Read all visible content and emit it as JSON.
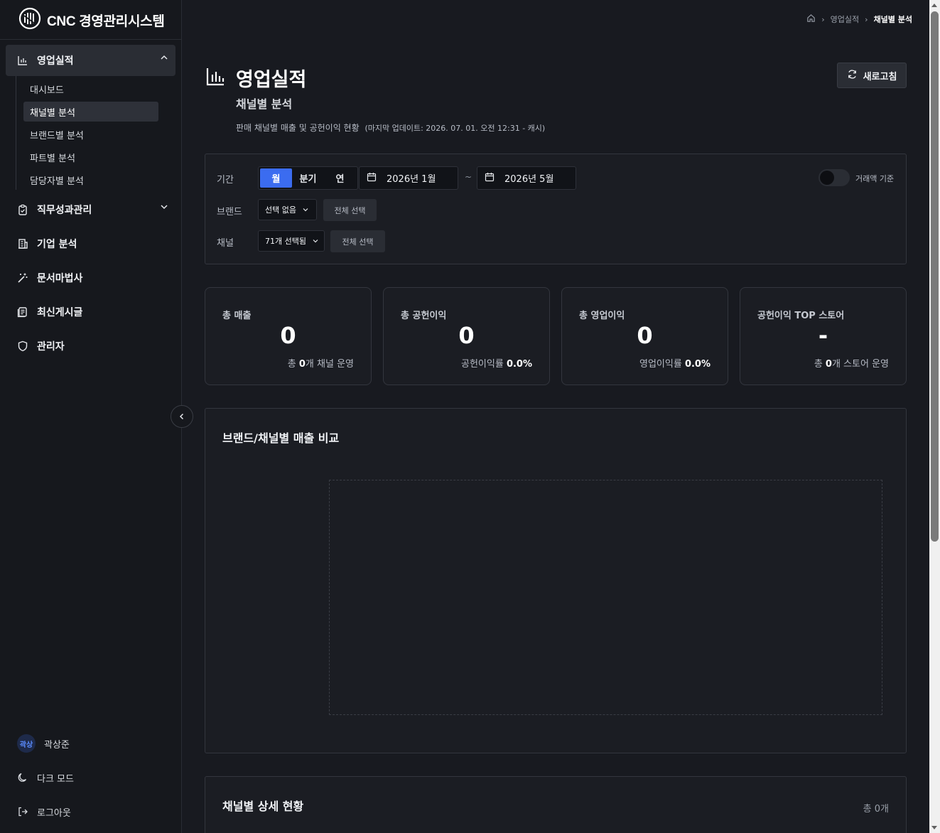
{
  "app": {
    "title": "CNC 경영관리시스템"
  },
  "sidebar": {
    "groups": [
      {
        "label": "영업실적",
        "icon": "bar-chart-icon",
        "expanded": true,
        "items": [
          {
            "label": "대시보드"
          },
          {
            "label": "채널별 분석",
            "active": true
          },
          {
            "label": "브랜드별 분석"
          },
          {
            "label": "파트별 분석"
          },
          {
            "label": "담당자별 분석"
          }
        ]
      },
      {
        "label": "직무성과관리",
        "icon": "clipboard-check-icon",
        "expanded": false
      },
      {
        "label": "기업 분석",
        "icon": "building-icon"
      },
      {
        "label": "문서마법사",
        "icon": "magic-wand-icon"
      },
      {
        "label": "최신게시글",
        "icon": "document-list-icon"
      },
      {
        "label": "관리자",
        "icon": "shield-icon"
      }
    ],
    "user": {
      "avatar_text": "곽상",
      "name": "곽상준"
    },
    "dark_mode_label": "다크 모드",
    "logout_label": "로그아웃"
  },
  "breadcrumb": {
    "items": [
      "영업실적",
      "채널별 분석"
    ]
  },
  "header": {
    "title": "영업실적",
    "subtitle": "채널별 분석",
    "description": "판매 채널별 매출 및 공헌이익 현황",
    "meta": "(마지막 업데이트: 2026. 07. 01. 오전 12:31 - 캐시)",
    "refresh_label": "새로고침"
  },
  "filters": {
    "period_label": "기간",
    "period_options": [
      "월",
      "분기",
      "연"
    ],
    "period_selected": "월",
    "date_from": "2026년 1월",
    "date_separator": "~",
    "date_to": "2026년 5월",
    "toggle_label": "거래액 기준",
    "toggle_on": false,
    "brand_label": "브랜드",
    "brand_value": "선택 없음",
    "brand_select_all": "전체 선택",
    "channel_label": "채널",
    "channel_value": "71개 선택됨",
    "channel_select_all": "전체 선택"
  },
  "stats": [
    {
      "label": "총 매출",
      "value": "0",
      "sub_prefix": "총 ",
      "sub_value": "0",
      "sub_suffix": "개 채널 운영"
    },
    {
      "label": "총 공헌이익",
      "value": "0",
      "sub_prefix": "공헌이익률 ",
      "sub_value": "0.0%",
      "sub_suffix": ""
    },
    {
      "label": "총 영업이익",
      "value": "0",
      "sub_prefix": "영업이익률 ",
      "sub_value": "0.0%",
      "sub_suffix": ""
    },
    {
      "label": "공헌이익 TOP 스토어",
      "value": "-",
      "sub_prefix": "총 ",
      "sub_value": "0",
      "sub_suffix": "개 스토어 운영"
    }
  ],
  "chart_section": {
    "title": "브랜드/채널별 매출 비교"
  },
  "detail_section": {
    "title": "채널별 상세 현황",
    "count": "총 0개"
  },
  "colors": {
    "accent": "#3b6cf0",
    "background": "#181a20",
    "card": "#1b1d23"
  }
}
